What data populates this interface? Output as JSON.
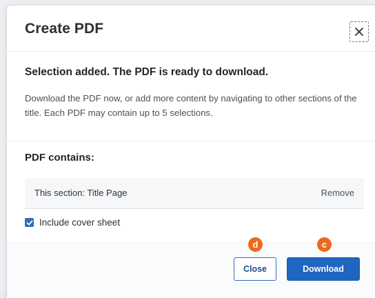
{
  "dialog": {
    "title": "Create PDF",
    "close_icon": "close-icon",
    "headline": "Selection added. The PDF is ready to download.",
    "description": "Download the PDF now, or add more content by navigating to other sections of the title. Each PDF may contain up to 5 selections.",
    "contains_label": "PDF contains:",
    "section_item": {
      "label": "This section: Title Page",
      "remove_label": "Remove"
    },
    "cover_sheet": {
      "label": "Include cover sheet",
      "checked": true
    },
    "buttons": {
      "close_label": "Close",
      "download_label": "Download"
    }
  },
  "markers": {
    "close_marker": "d",
    "download_marker": "c"
  },
  "colors": {
    "primary": "#1f66c1",
    "marker": "#ea6a1c",
    "checkbox": "#2f6fb7"
  }
}
